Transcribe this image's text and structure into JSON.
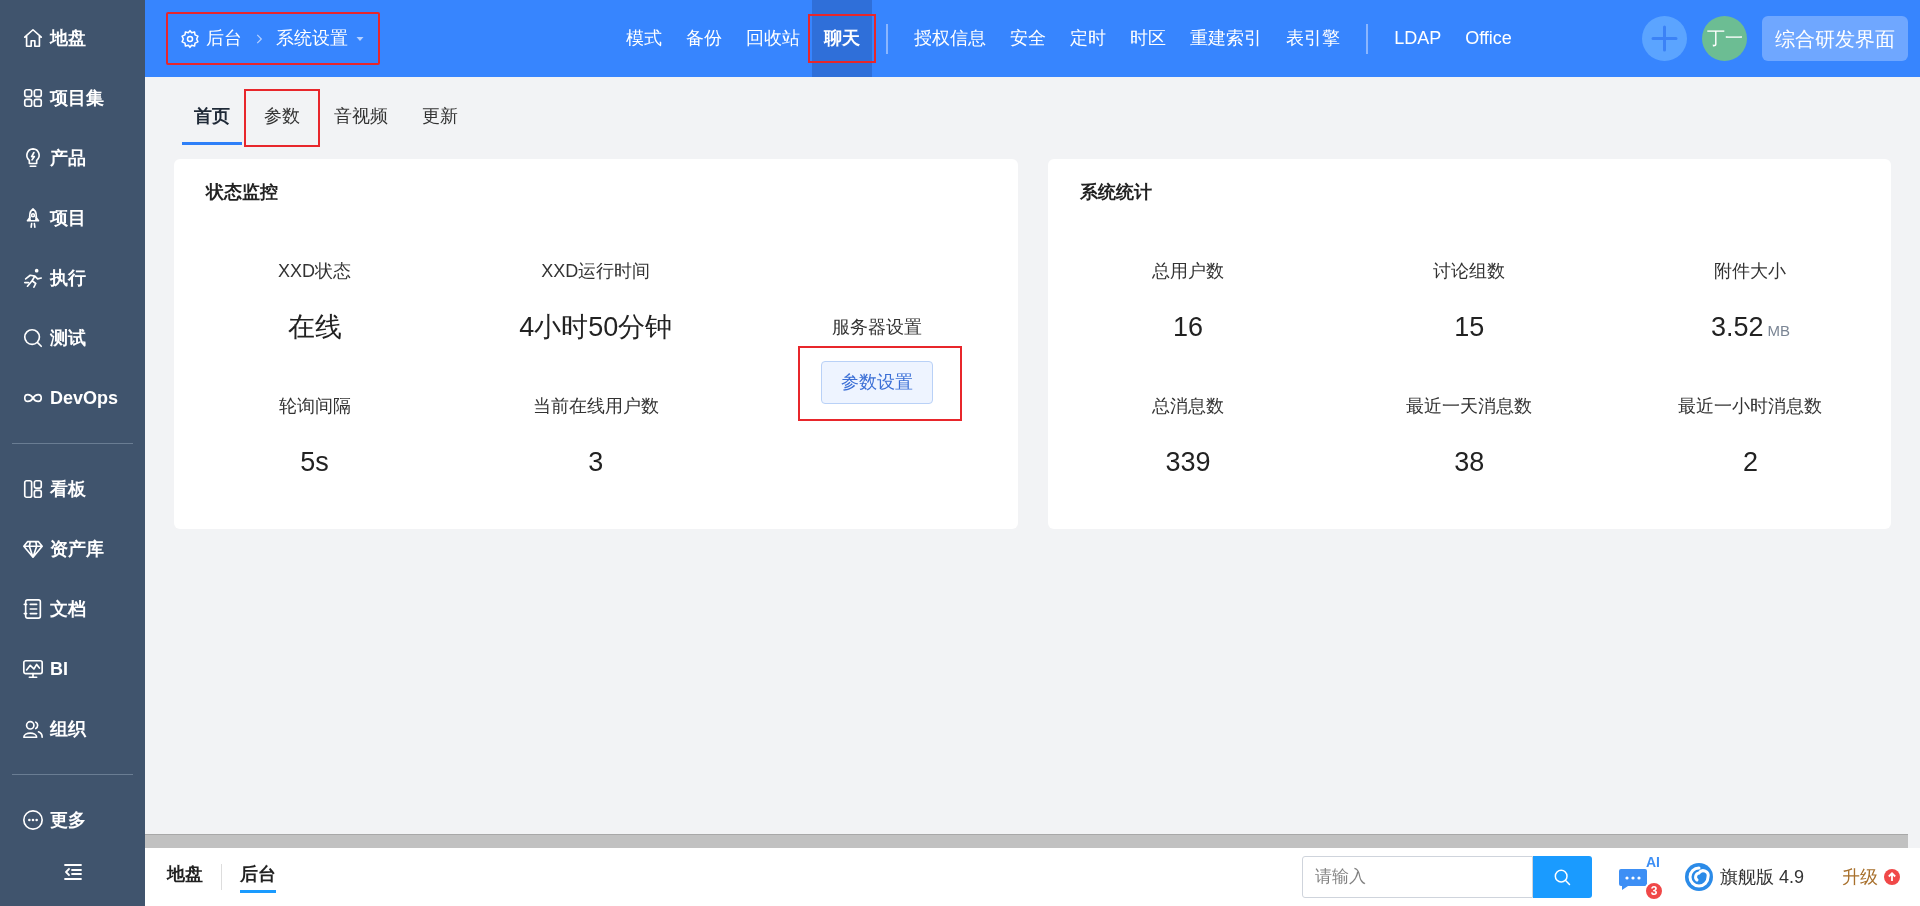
{
  "sidebar": {
    "groups": [
      [
        {
          "label": "地盘"
        },
        {
          "label": "项目集"
        },
        {
          "label": "产品"
        },
        {
          "label": "项目"
        },
        {
          "label": "执行"
        },
        {
          "label": "测试"
        },
        {
          "label": "DevOps"
        }
      ],
      [
        {
          "label": "看板"
        },
        {
          "label": "资产库"
        },
        {
          "label": "文档"
        },
        {
          "label": "BI"
        },
        {
          "label": "组织"
        }
      ],
      [
        {
          "label": "更多"
        }
      ]
    ]
  },
  "top_bar": {
    "breadcrumb": {
      "root": "后台",
      "current": "系统设置",
      "highlighted": true
    },
    "nav_groups": [
      [
        {
          "label": "模式",
          "selected": false,
          "highlighted": false
        },
        {
          "label": "备份",
          "selected": false,
          "highlighted": false
        },
        {
          "label": "回收站",
          "selected": false,
          "highlighted": false
        },
        {
          "label": "聊天",
          "selected": true,
          "highlighted": true
        }
      ],
      [
        {
          "label": "授权信息",
          "selected": false,
          "highlighted": false
        },
        {
          "label": "安全",
          "selected": false,
          "highlighted": false
        },
        {
          "label": "定时",
          "selected": false,
          "highlighted": false
        },
        {
          "label": "时区",
          "selected": false,
          "highlighted": false
        },
        {
          "label": "重建索引",
          "selected": false,
          "highlighted": false
        },
        {
          "label": "表引擎",
          "selected": false,
          "highlighted": false
        }
      ],
      [
        {
          "label": "LDAP",
          "selected": false,
          "highlighted": false
        },
        {
          "label": "Office",
          "selected": false,
          "highlighted": false
        }
      ]
    ],
    "avatar": "丁一",
    "workspace_button": "综合研发界面"
  },
  "tabs": [
    {
      "label": "首页",
      "selected": true,
      "highlighted": false
    },
    {
      "label": "参数",
      "selected": false,
      "highlighted": true
    },
    {
      "label": "音视频",
      "selected": false,
      "highlighted": false
    },
    {
      "label": "更新",
      "selected": false,
      "highlighted": false
    }
  ],
  "status_card": {
    "title": "状态监控",
    "metrics": [
      {
        "label": "XXD状态",
        "value": "在线"
      },
      {
        "label": "XXD运行时间",
        "value": "4小时50分钟"
      },
      {
        "label": "轮询间隔",
        "value": "5s"
      },
      {
        "label": "当前在线用户数",
        "value": "3"
      }
    ],
    "server": {
      "label": "服务器设置",
      "button": "参数设置",
      "highlighted": true
    }
  },
  "stats_card": {
    "title": "系统统计",
    "metrics": [
      {
        "label": "总用户数",
        "value": "16"
      },
      {
        "label": "讨论组数",
        "value": "15"
      },
      {
        "label": "附件大小",
        "value": "3.52",
        "unit": "MB"
      },
      {
        "label": "总消息数",
        "value": "339"
      },
      {
        "label": "最近一天消息数",
        "value": "38"
      },
      {
        "label": "最近一小时消息数",
        "value": "2"
      }
    ]
  },
  "bottom_bar": {
    "tabs": [
      {
        "label": "地盘",
        "selected": false
      },
      {
        "label": "后台",
        "selected": true
      }
    ],
    "search": {
      "placeholder": "请输入"
    },
    "ai": {
      "label": "AI",
      "badge": "3"
    },
    "edition": "旗舰版 4.9",
    "upgrade": "升级"
  }
}
